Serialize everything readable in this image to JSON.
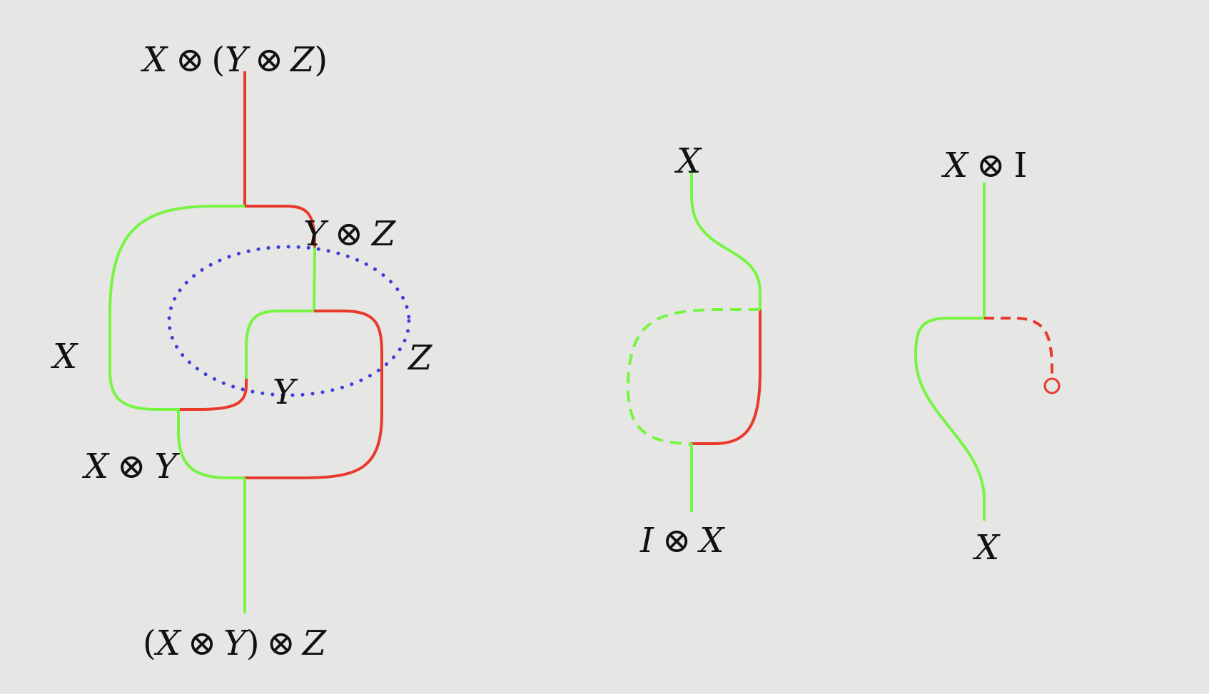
{
  "colors": {
    "background": "#e6e6e5",
    "green": "#77f542",
    "red": "#e83a2a",
    "blue": "#3c3ce0",
    "text": "#111111"
  },
  "associator": {
    "top_label": {
      "x": "X",
      "otimes1": "⊗",
      "lparen": "(",
      "y": "Y",
      "otimes2": "⊗",
      "z": "Z",
      "rparen": ")"
    },
    "yz_label": {
      "y": "Y",
      "otimes": "⊗",
      "z": "Z"
    },
    "x_label": "X",
    "z_label": "Z",
    "y_label": "Y",
    "xy_label": {
      "x": "X",
      "otimes": "⊗",
      "y": "Y"
    },
    "bottom_label": {
      "lparen": "(",
      "x": "X",
      "otimes1": "⊗",
      "y": "Y",
      "rparen": ")",
      "otimes2": "⊗",
      "z": "Z"
    }
  },
  "left_unitor": {
    "top_label": "X",
    "bottom_label": {
      "i": "I",
      "otimes": "⊗",
      "x": "X"
    }
  },
  "right_unitor": {
    "top_label": {
      "x": "X",
      "otimes": "⊗",
      "i": "I"
    },
    "bottom_label": "X"
  }
}
